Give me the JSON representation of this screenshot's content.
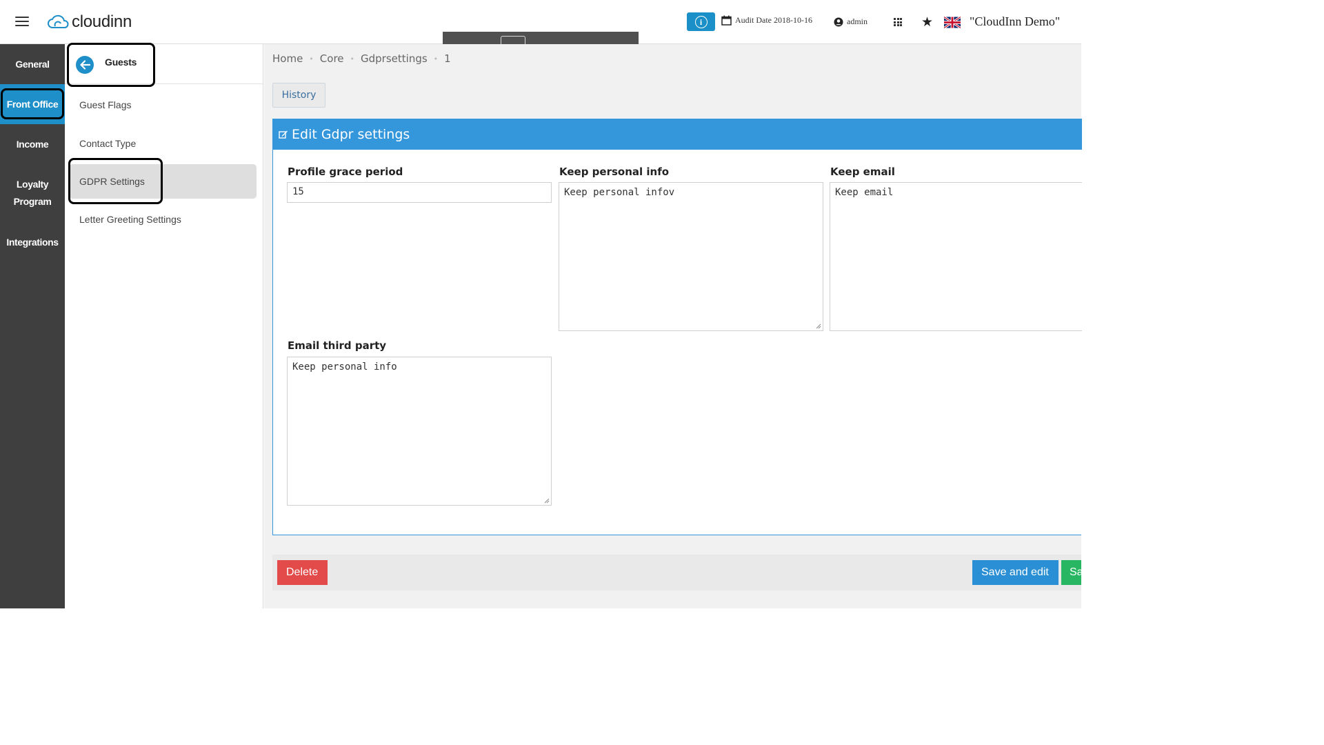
{
  "header": {
    "brand": "cloudinn",
    "audit_date": "Audit Date 2018-10-16",
    "user": "admin",
    "hotel_name": "\"CloudInn Demo\"",
    "info_glyph": "i",
    "star_glyph": "★"
  },
  "sidebar": {
    "items": [
      {
        "label": "General"
      },
      {
        "label": "Front Office"
      },
      {
        "label": "Income"
      },
      {
        "label": "Loyalty Program"
      },
      {
        "label": "Integrations"
      }
    ]
  },
  "submenu": {
    "title": "Guests",
    "items": [
      {
        "label": "Guest Flags"
      },
      {
        "label": "Contact Type"
      },
      {
        "label": "GDPR Settings"
      },
      {
        "label": "Letter Greeting Settings"
      }
    ]
  },
  "breadcrumb": {
    "items": [
      "Home",
      "Core",
      "Gdprsettings",
      "1"
    ],
    "separator": "•"
  },
  "history_label": "History",
  "form": {
    "title": "Edit Gdpr settings",
    "fields": {
      "profile_grace_period": {
        "label": "Profile grace period",
        "value": "15"
      },
      "keep_personal_info": {
        "label": "Keep personal info",
        "value": "Keep personal infov"
      },
      "keep_email": {
        "label": "Keep email",
        "value": "Keep email"
      },
      "email_third_party": {
        "label": "Email third party",
        "value": "Keep personal info"
      }
    }
  },
  "actions": {
    "delete": "Delete",
    "save_and_edit": "Save and edit",
    "save": "Sa"
  },
  "colors": {
    "accent": "#1e8fc9",
    "panel_header": "#3496db",
    "delete": "#e34a4a",
    "save": "#28b662",
    "sidebar_bg": "#3f3f3f"
  }
}
